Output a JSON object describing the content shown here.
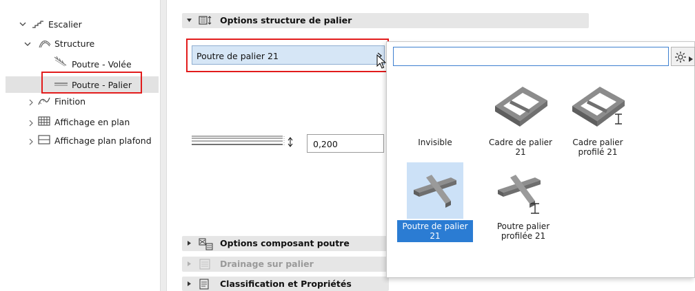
{
  "tree": {
    "items": [
      {
        "label": "Escalier",
        "icon": "stair-icon",
        "expanded": true
      },
      {
        "label": "Structure",
        "icon": "structure-icon",
        "expanded": true
      },
      {
        "label": "Poutre - Volée",
        "icon": "flight-beam-icon"
      },
      {
        "label": "Poutre - Palier",
        "icon": "landing-beam-icon",
        "selected": true
      },
      {
        "label": "Finition",
        "icon": "finish-icon",
        "expanded": false
      },
      {
        "label": "Affichage en plan",
        "icon": "floorplan-display-icon",
        "expanded": false
      },
      {
        "label": "Affichage plan plafond",
        "icon": "ceiling-plan-icon",
        "expanded": false
      }
    ]
  },
  "sections": {
    "landing_structure": {
      "title": "Options structure de palier",
      "expanded": true
    },
    "beam_component": {
      "title": "Options composant poutre",
      "expanded": false
    },
    "landing_drainage": {
      "title": "Drainage sur palier",
      "expanded": false,
      "disabled": true
    },
    "classification": {
      "title": "Classification et Propriétés",
      "expanded": false
    }
  },
  "combo": {
    "value": "Poutre de palier 21"
  },
  "thickness": {
    "value": "0,200"
  },
  "popup": {
    "search_value": "",
    "items": [
      {
        "label_line1": "Invisible",
        "label_line2": "",
        "selected": false
      },
      {
        "label_line1": "Cadre de palier",
        "label_line2": "21",
        "selected": false
      },
      {
        "label_line1": "Cadre palier",
        "label_line2": "profilé 21",
        "selected": false
      },
      {
        "label_line1": "Poutre de palier",
        "label_line2": "21",
        "selected": true
      },
      {
        "label_line1": "Poutre palier",
        "label_line2": "profilée 21",
        "selected": false
      }
    ]
  },
  "colors": {
    "highlight_red": "#e21b1b",
    "selection_blue": "#2b7cd3",
    "combo_blue": "#d6e6f6",
    "section_grey": "#e6e6e6"
  }
}
